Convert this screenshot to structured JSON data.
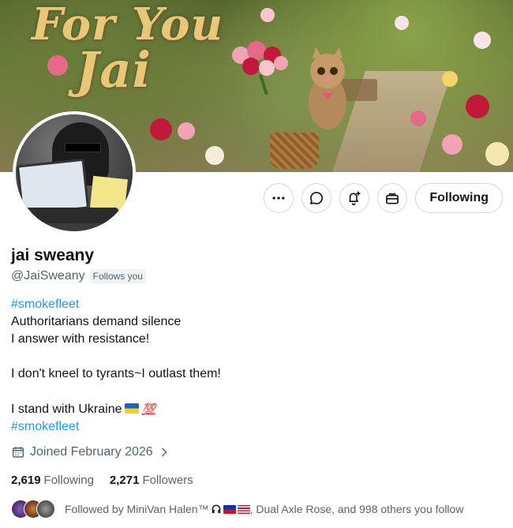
{
  "banner": {
    "art_text_line1": "For You",
    "art_text_line2": "Jai"
  },
  "profile": {
    "name": "jai sweany",
    "handle": "@JaiSweany",
    "follows_you_badge": "Follows you"
  },
  "actions": {
    "more_icon": "more-horizontal-icon",
    "message_icon": "message-icon",
    "notify_icon": "bell-plus-icon",
    "subscribe_icon": "gift-icon",
    "follow_label": "Following"
  },
  "bio": {
    "hashtag1": "#smokefleet",
    "line1": "Authoritarians demand silence",
    "line2": "I answer with resistance!",
    "line3": "I don't kneel to tyrants~I outlast them!",
    "line4": "I stand with Ukraine",
    "hundred_emoji": "💯",
    "hashtag2": "#smokefleet"
  },
  "joined": {
    "icon": "calendar-icon",
    "text": "Joined February 2026"
  },
  "stats": {
    "following_count": "2,619",
    "following_label": "Following",
    "followers_count": "2,271",
    "followers_label": "Followers"
  },
  "followed_by": {
    "prefix": "Followed by MiniVan Halen™",
    "suffix": ", Dual Axle Rose, and 998 others you follow"
  },
  "colors": {
    "link": "#1d9bf0",
    "muted": "#536471",
    "text": "#0f1419",
    "border": "#cfd9de"
  }
}
